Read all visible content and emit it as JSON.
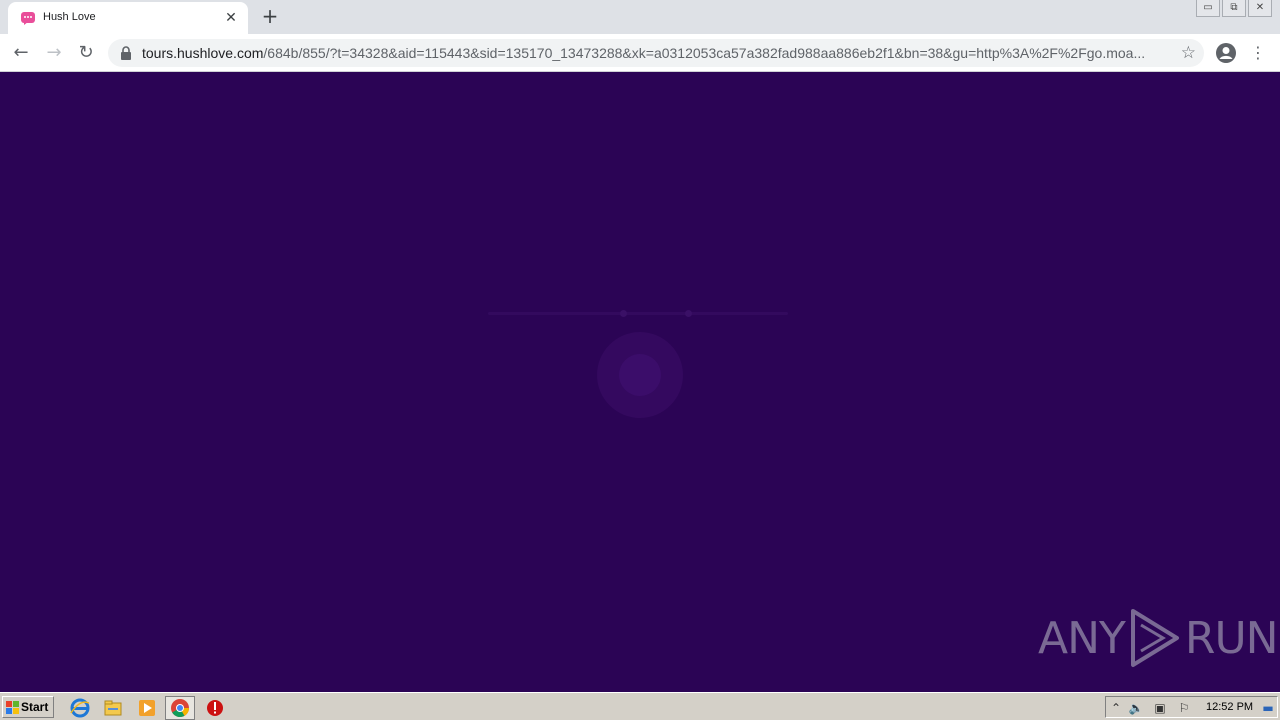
{
  "browser": {
    "tab": {
      "title": "Hush Love",
      "close_glyph": "✕",
      "favicon": "hushlove-favicon-icon"
    },
    "new_tab_glyph": "+",
    "window_controls": {
      "minimize": "▭",
      "restore": "⧉",
      "close": "✕"
    },
    "toolbar": {
      "back_glyph": "←",
      "forward_glyph": "→",
      "reload_glyph": "↻",
      "url_host": "tours.hushlove.com",
      "url_path": "/684b/855/?t=34328&aid=115443&sid=135170_13473288&xk=a0312053ca57a382fad988aa886eb2f1&bn=38&gu=http%3A%2F%2Fgo.moa...",
      "bookmark_glyph": "☆",
      "menu_glyph": "⋮"
    }
  },
  "page": {
    "background": "#2b0455",
    "watermark": {
      "left": "ANY",
      "right": "RUN"
    }
  },
  "taskbar": {
    "start_label": "Start",
    "clock": "12:52 PM",
    "tray_icons": [
      "up-arrow-icon",
      "volume-icon",
      "network-icon",
      "flag-icon",
      "desktop-icon"
    ]
  }
}
